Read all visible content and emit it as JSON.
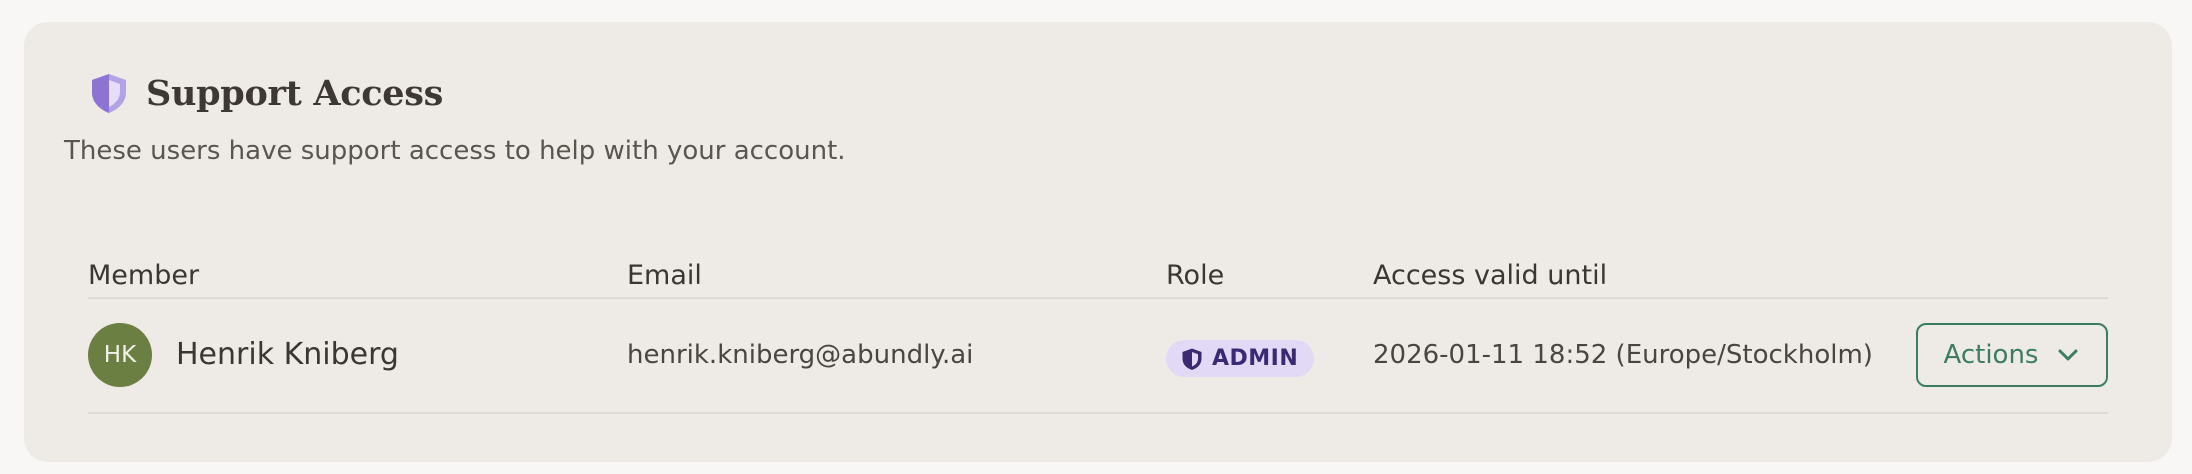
{
  "section": {
    "title": "Support Access",
    "subtitle": "These users have support access to help with your account."
  },
  "table": {
    "headers": {
      "member": "Member",
      "email": "Email",
      "role": "Role",
      "valid_until": "Access valid until"
    },
    "rows": [
      {
        "initials": "HK",
        "name": "Henrik Kniberg",
        "email": "henrik.kniberg@abundly.ai",
        "role": "ADMIN",
        "valid_until": "2026-01-11 18:52 (Europe/Stockholm)",
        "actions_label": "Actions"
      }
    ]
  },
  "icons": {
    "title_icon": "shield-icon",
    "role_icon": "shield-icon",
    "actions_icon": "chevron-down-icon"
  },
  "colors": {
    "card_bg": "#eeebe6",
    "shield_purple": "#9b86d6",
    "badge_bg": "#e2d9f7",
    "badge_text": "#3b2a73",
    "avatar_bg": "#6b7f42",
    "action_green": "#3a7d63"
  }
}
